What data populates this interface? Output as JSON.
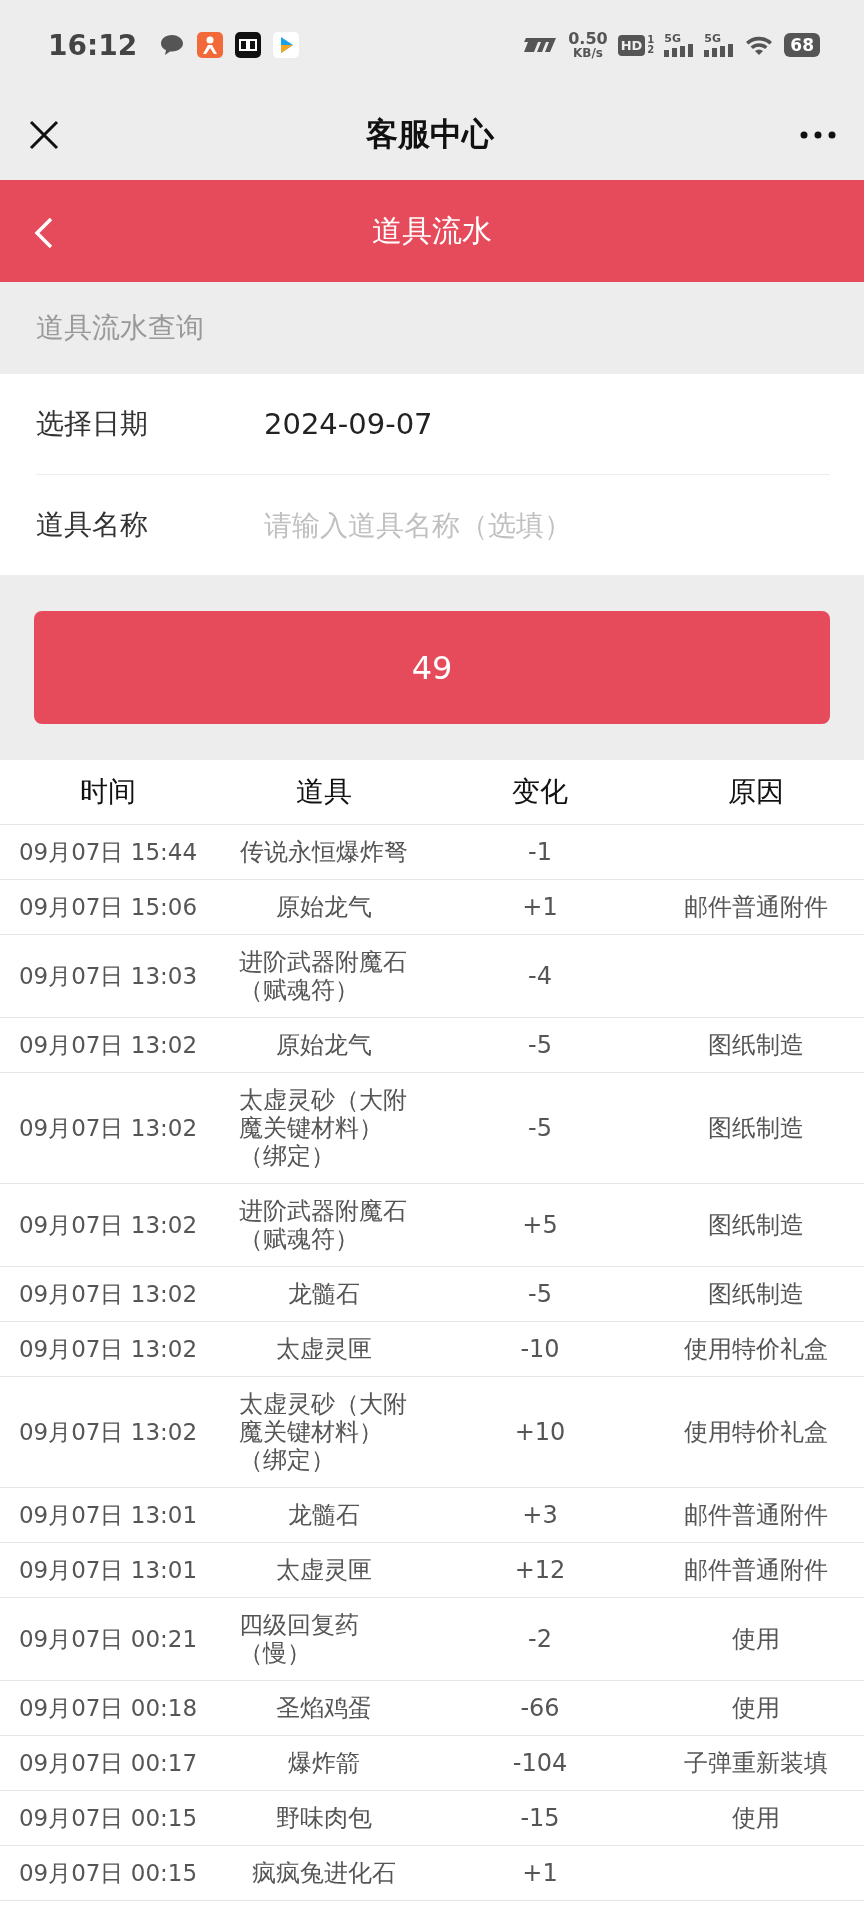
{
  "status_bar": {
    "time": "16:12",
    "speed_value": "0.50",
    "speed_unit": "KB/s",
    "hd": "HD",
    "hd_sub": [
      "1",
      "2"
    ],
    "sim_labels": [
      "5G",
      "5G"
    ],
    "battery": "68"
  },
  "nav": {
    "title": "客服中心"
  },
  "header": {
    "title": "道具流水"
  },
  "section": {
    "title": "道具流水查询"
  },
  "form": {
    "fields": [
      {
        "kind": "value",
        "label": "选择日期",
        "value": "2024-09-07"
      },
      {
        "kind": "input",
        "label": "道具名称",
        "placeholder": "请输入道具名称（选填）"
      }
    ]
  },
  "query_button": {
    "label": "49"
  },
  "table": {
    "columns": [
      "时间",
      "道具",
      "变化",
      "原因"
    ],
    "rows": [
      {
        "time": "09月07日 15:44",
        "item": "传说永恒爆炸弩",
        "change": "-1"
      },
      {
        "time": "09月07日 15:06",
        "item": "原始龙气",
        "change": "+1",
        "reason": "邮件普通附件"
      },
      {
        "time": "09月07日 13:03",
        "item": "进阶武器附魔石（赋魂符）",
        "change": "-4"
      },
      {
        "time": "09月07日 13:02",
        "item": "原始龙气",
        "change": "-5",
        "reason": "图纸制造"
      },
      {
        "time": "09月07日 13:02",
        "item": "太虚灵砂（大附魔关键材料）（绑定）",
        "change": "-5",
        "reason": "图纸制造"
      },
      {
        "time": "09月07日 13:02",
        "item": "进阶武器附魔石（赋魂符）",
        "change": "+5",
        "reason": "图纸制造"
      },
      {
        "time": "09月07日 13:02",
        "item": "龙髓石",
        "change": "-5",
        "reason": "图纸制造"
      },
      {
        "time": "09月07日 13:02",
        "item": "太虚灵匣",
        "change": "-10",
        "reason": "使用特价礼盒"
      },
      {
        "time": "09月07日 13:02",
        "item": "太虚灵砂（大附魔关键材料）（绑定）",
        "change": "+10",
        "reason": "使用特价礼盒"
      },
      {
        "time": "09月07日 13:01",
        "item": "龙髓石",
        "change": "+3",
        "reason": "邮件普通附件"
      },
      {
        "time": "09月07日 13:01",
        "item": "太虚灵匣",
        "change": "+12",
        "reason": "邮件普通附件"
      },
      {
        "time": "09月07日 00:21",
        "item": "四级回复药（慢）",
        "change": "-2",
        "reason": "使用"
      },
      {
        "time": "09月07日 00:18",
        "item": "圣焰鸡蛋",
        "change": "-66",
        "reason": "使用"
      },
      {
        "time": "09月07日 00:17",
        "item": "爆炸箭",
        "change": "-104",
        "reason": "子弹重新装填"
      },
      {
        "time": "09月07日 00:15",
        "item": "野味肉包",
        "change": "-15",
        "reason": "使用"
      },
      {
        "time": "09月07日 00:15",
        "item": "疯疯兔进化石",
        "change": "+1"
      }
    ]
  }
}
